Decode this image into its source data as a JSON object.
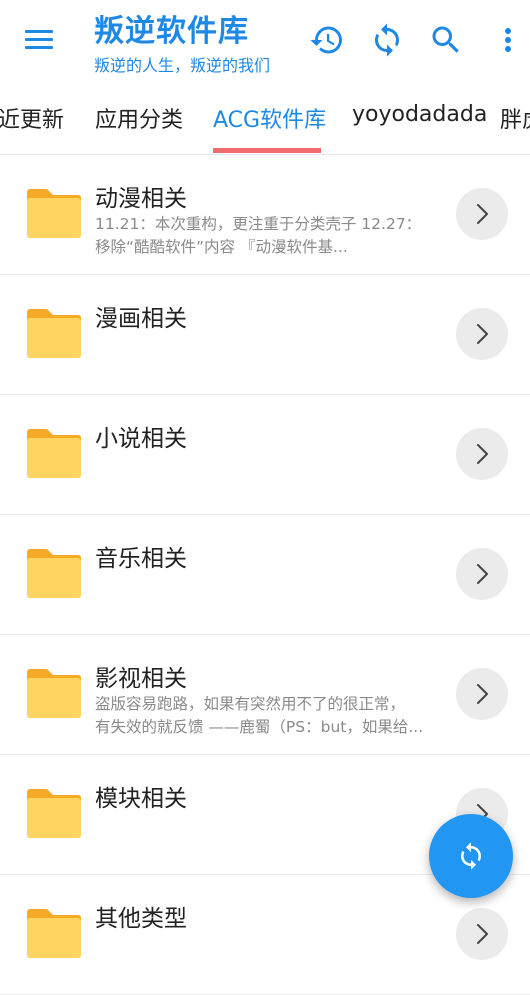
{
  "app": {
    "title": "叛逆软件库",
    "subtitle": "叛逆的人生，叛逆的我们",
    "accent_color": "#1e88e5",
    "indicator_color": "#f06b6b",
    "fab_color": "#2196f3",
    "actions": [
      "history-icon",
      "refresh-icon",
      "search-icon",
      "more-vert-icon"
    ]
  },
  "tabs": [
    {
      "label": "近更新"
    },
    {
      "label": "应用分类"
    },
    {
      "label": "ACG软件库",
      "active": true
    },
    {
      "label": "yoyodadada"
    },
    {
      "label": "胖虎"
    }
  ],
  "list": [
    {
      "title": "动漫相关",
      "desc": [
        "11.21：本次重构，更注重于分类壳子 12.27：",
        "移除“酷酷软件”内容 『动漫软件基..."
      ]
    },
    {
      "title": "漫画相关",
      "desc": []
    },
    {
      "title": "小说相关",
      "desc": []
    },
    {
      "title": "音乐相关",
      "desc": []
    },
    {
      "title": "影视相关",
      "desc": [
        "盗版容易跑路，如果有突然用不了的很正常，",
        "有失效的就反馈 ——鹿蜀（PS：but，如果给..."
      ]
    },
    {
      "title": "模块相关",
      "desc": []
    },
    {
      "title": "其他类型",
      "desc": []
    }
  ]
}
